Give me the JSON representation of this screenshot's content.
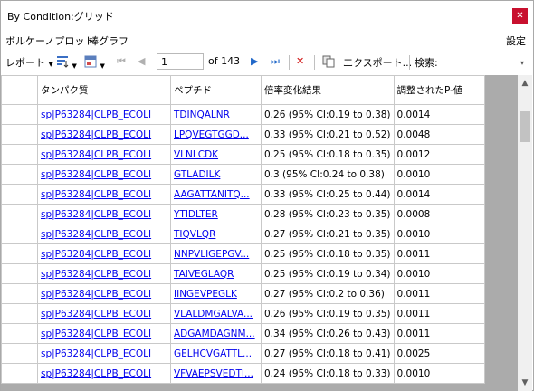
{
  "window": {
    "title": "By Condition:グリッド",
    "close_icon": "close-icon"
  },
  "menu": {
    "volcano": "ボルケーノプロット",
    "bar": "棒グラフ",
    "settings": "設定"
  },
  "toolbar": {
    "report": "レポート",
    "page_value": "1",
    "page_of": "of 143",
    "export": "エクスポート...",
    "search": "検索:"
  },
  "grid": {
    "headers": [
      "タンパク質",
      "ペプチド",
      "倍率変化結果",
      "調整されたP-値"
    ],
    "rows": [
      {
        "protein": "sp|P63284|CLPB_ECOLI",
        "peptide": "TDINQALNR",
        "fold": "0.26 (95% CI:0.19 to 0.38)",
        "p": "0.0014"
      },
      {
        "protein": "sp|P63284|CLPB_ECOLI",
        "peptide": "LPQVEGTGGD...",
        "fold": "0.33 (95% CI:0.21 to 0.52)",
        "p": "0.0048"
      },
      {
        "protein": "sp|P63284|CLPB_ECOLI",
        "peptide": "VLNLCDK",
        "fold": "0.25 (95% CI:0.18 to 0.35)",
        "p": "0.0012"
      },
      {
        "protein": "sp|P63284|CLPB_ECOLI",
        "peptide": "GTLADILK",
        "fold": "0.3 (95% CI:0.24 to 0.38)",
        "p": "0.0010"
      },
      {
        "protein": "sp|P63284|CLPB_ECOLI",
        "peptide": "AAGATTANITQ...",
        "fold": "0.33 (95% CI:0.25 to 0.44)",
        "p": "0.0014"
      },
      {
        "protein": "sp|P63284|CLPB_ECOLI",
        "peptide": "YTIDLTER",
        "fold": "0.28 (95% CI:0.23 to 0.35)",
        "p": "0.0008"
      },
      {
        "protein": "sp|P63284|CLPB_ECOLI",
        "peptide": "TIQVLQR",
        "fold": "0.27 (95% CI:0.21 to 0.35)",
        "p": "0.0010"
      },
      {
        "protein": "sp|P63284|CLPB_ECOLI",
        "peptide": "NNPVLIGEPGV...",
        "fold": "0.25 (95% CI:0.18 to 0.35)",
        "p": "0.0011"
      },
      {
        "protein": "sp|P63284|CLPB_ECOLI",
        "peptide": "TAIVEGLAQR",
        "fold": "0.25 (95% CI:0.19 to 0.34)",
        "p": "0.0010"
      },
      {
        "protein": "sp|P63284|CLPB_ECOLI",
        "peptide": "IINGEVPEGLK",
        "fold": "0.27 (95% CI:0.2 to 0.36)",
        "p": "0.0011"
      },
      {
        "protein": "sp|P63284|CLPB_ECOLI",
        "peptide": "VLALDMGALVA...",
        "fold": "0.26 (95% CI:0.19 to 0.35)",
        "p": "0.0011"
      },
      {
        "protein": "sp|P63284|CLPB_ECOLI",
        "peptide": "ADGAMDAGNM...",
        "fold": "0.34 (95% CI:0.26 to 0.43)",
        "p": "0.0011"
      },
      {
        "protein": "sp|P63284|CLPB_ECOLI",
        "peptide": "GELHCVGATTL...",
        "fold": "0.27 (95% CI:0.18 to 0.41)",
        "p": "0.0025"
      },
      {
        "protein": "sp|P63284|CLPB_ECOLI",
        "peptide": "VFVAEPSVEDTI...",
        "fold": "0.24 (95% CI:0.18 to 0.33)",
        "p": "0.0010"
      }
    ]
  }
}
